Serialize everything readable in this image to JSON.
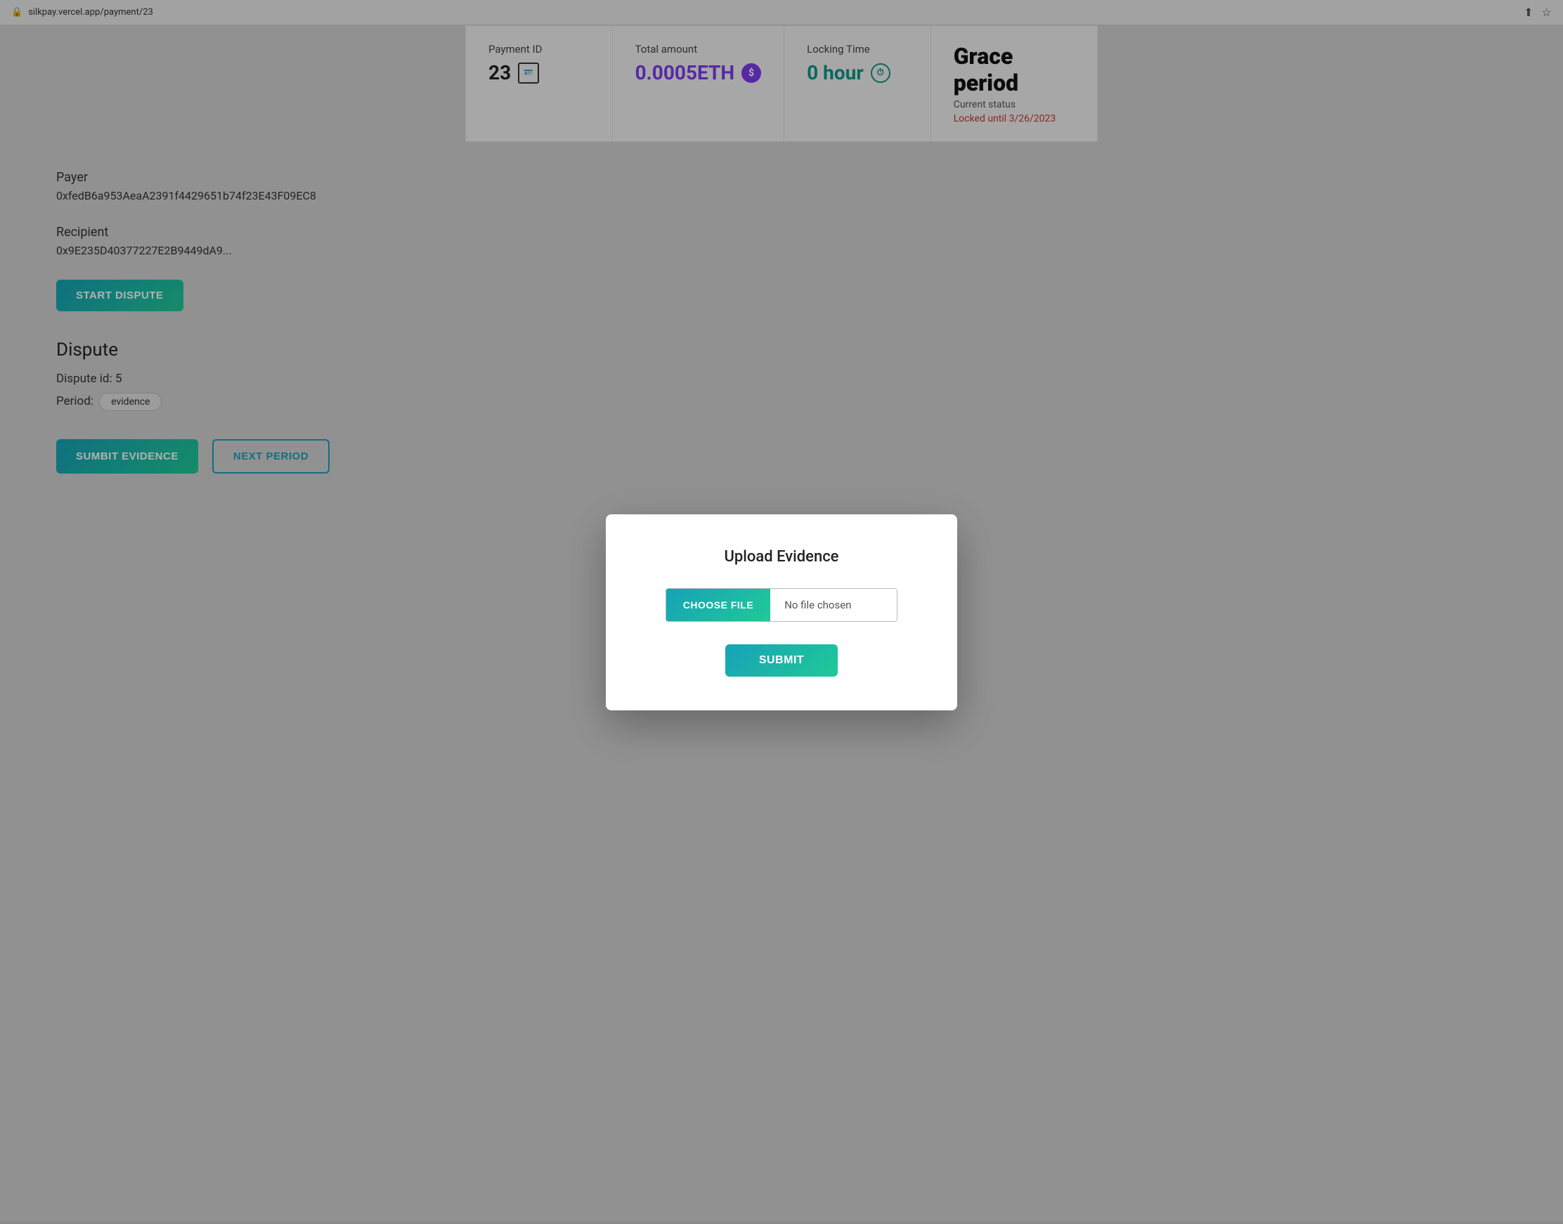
{
  "browser": {
    "url": "silkpay.vercel.app/payment/23",
    "lock_icon": "🔒"
  },
  "payment_card": {
    "payment_id_label": "Payment ID",
    "payment_id_value": "23",
    "total_amount_label": "Total amount",
    "total_amount_value": "0.0005ETH",
    "locking_time_label": "Locking Time",
    "locking_time_value": "0 hour",
    "grace_period_title": "Grace period",
    "current_status_label": "Current status",
    "locked_until": "Locked until 3/26/2023"
  },
  "payer": {
    "label": "Payer",
    "address": "0xfedB6a953AeaA2391f4429651b74f23E43F09EC8"
  },
  "recipient": {
    "label": "Recipient",
    "address": "0x9E235D40377227E2B9449dA9..."
  },
  "start_dispute_button": "START DISPUTE",
  "dispute": {
    "title": "Dispute",
    "id_label": "Dispute id: 5",
    "period_label": "Period:",
    "period_badge": "evidence"
  },
  "bottom_buttons": {
    "submit_evidence": "SUMBIT EVIDENCE",
    "next_period": "NEXT PERIOD"
  },
  "modal": {
    "title": "Upload Evidence",
    "choose_file_label": "CHOOSE FILE",
    "no_file_chosen": "No file chosen",
    "submit_label": "SUBMIT"
  }
}
